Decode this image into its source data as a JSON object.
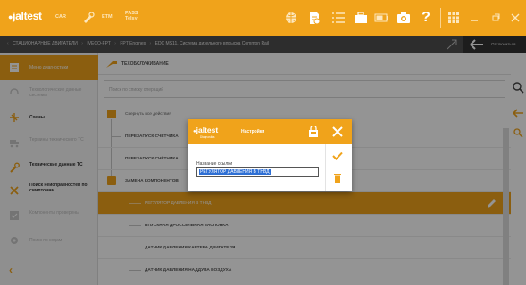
{
  "topbar": {
    "logo": "jaltest",
    "tabs": [
      "CAR",
      "ETM",
      "PASS Telsy"
    ],
    "icons": [
      "logo-dot-icon",
      "car-icon",
      "tools-icon",
      "etm-icon",
      "globe-icon",
      "document-icon",
      "list-icon",
      "briefcase-icon",
      "battery-icon",
      "camera-icon",
      "help-icon",
      "grid-icon",
      "minimize-icon",
      "restore-icon",
      "close-icon"
    ],
    "color": "#f0a31b"
  },
  "breadcrumb": {
    "items": [
      "СТАЦИОНАРНЫЕ ДВИГАТЕЛИ",
      "IVECO-FPT",
      "FPT Engines",
      "EDC MS11. Система дизельного впрыска Common Rail"
    ],
    "back_label": "Отключиться"
  },
  "sidebar": {
    "items": [
      {
        "label": "Меню диагностики",
        "state": "active"
      },
      {
        "label": "Технологические данные системы",
        "state": "muted"
      },
      {
        "label": "Схемы",
        "state": "normal"
      },
      {
        "label": "Термины технического ТС",
        "state": "muted"
      },
      {
        "label": "Технические данные ТС",
        "state": "normal"
      },
      {
        "label": "Поиск неисправностей по симптомам",
        "state": "normal"
      },
      {
        "label": "Компоненты проверены",
        "state": "muted"
      },
      {
        "label": "Поиск по кодам",
        "state": "muted"
      }
    ]
  },
  "main": {
    "title": "ТЕХОБСЛУЖИВАНИЕ",
    "search_placeholder": "Поиск по списку операций",
    "collapse_label": "Свернуть все действия",
    "rows": [
      {
        "label": "ПЕРЕЗАПУСК СЧЁТЧИКА",
        "level": 1
      },
      {
        "label": "ПЕРЕЗАПУСК СЧЁТЧИКА",
        "level": 1
      },
      {
        "label": "ЗАМЕНА КОМПОНЕНТОВ",
        "level": 0
      },
      {
        "label": "РЕГУЛЯТОР ДАВЛЕНИЯ В ТНВД",
        "level": 2,
        "selected": true
      },
      {
        "label": "ВПУСКНАЯ ДРОССЕЛЬНАЯ ЗАСЛОНКА",
        "level": 2
      },
      {
        "label": "ДАТЧИК ДАВЛЕНИЯ КАРТЕРА ДВИГАТЕЛЯ",
        "level": 2
      },
      {
        "label": "ДАТЧИК ДАВЛЕНИЯ НАДДУВА ВОЗДУХА",
        "level": 2
      }
    ]
  },
  "dialog": {
    "logo": "jaltest",
    "logo_sub": "Diagnostics",
    "title": "Настройки",
    "field_label": "Название ссылки",
    "field_value": "РЕГУЛЯТОР ДАВЛЕНИЯ В ТНВД"
  }
}
